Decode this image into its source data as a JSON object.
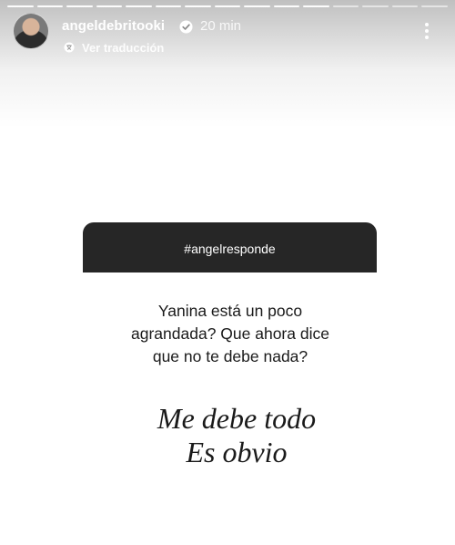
{
  "header": {
    "username": "angeldebritooki",
    "time": "20 min",
    "translate_label": "Ver traducción",
    "verified_icon": "verified-icon",
    "more_icon": "more-vertical-icon"
  },
  "progress": {
    "segments": 15,
    "current_segment": 11
  },
  "question_sticker": {
    "hashtag": "#angelresponde",
    "question_line1": "Yanina está un poco",
    "question_line2": "agrandada? Que ahora dice",
    "question_line3": "que no te debe nada?",
    "header_color": "#262626"
  },
  "answer": {
    "line1": "Me debe todo",
    "line2": "Es obvio"
  }
}
